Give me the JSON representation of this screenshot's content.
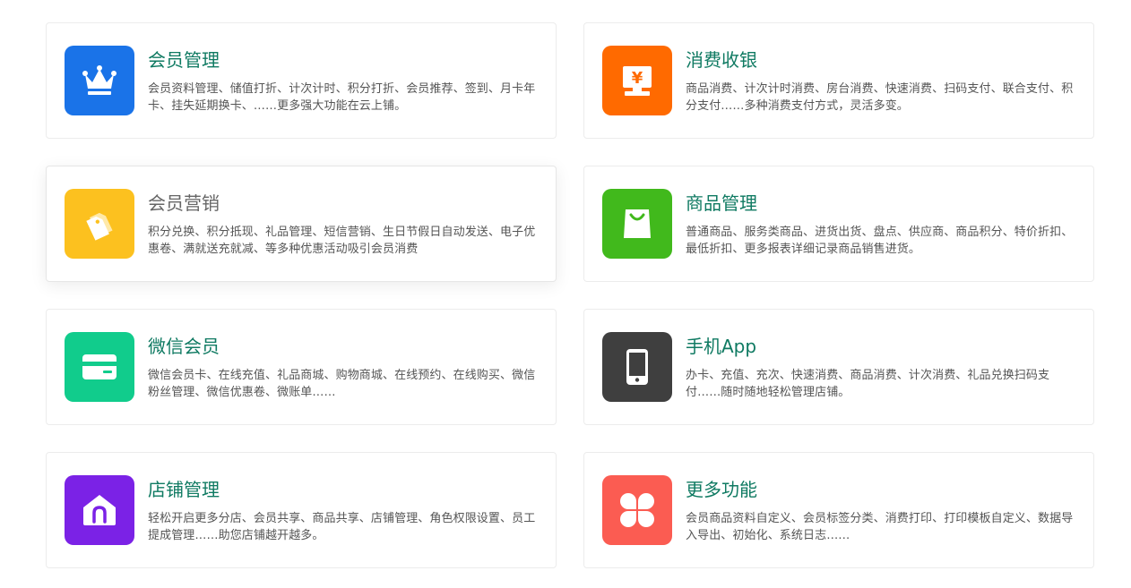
{
  "features": [
    {
      "title": "会员管理",
      "desc": "会员资料管理、储值打折、计次计时、积分打折、会员推荐、签到、月卡年卡、挂失延期换卡、……更多强大功能在云上铺。",
      "icon": "crown-icon",
      "color": "#1a73e8"
    },
    {
      "title": "消费收银",
      "desc": "商品消费、计次计时消费、房台消费、快速消费、扫码支付、联合支付、积分支付……多种消费支付方式，灵活多变。",
      "icon": "cash-register-icon",
      "color": "#ff6a00"
    },
    {
      "title": "会员营销",
      "desc": "积分兑换、积分抵现、礼品管理、短信营销、生日节假日自动发送、电子优惠卷、满就送充就减、等多种优惠活动吸引会员消费",
      "icon": "price-tags-icon",
      "color": "#fcc11f"
    },
    {
      "title": "商品管理",
      "desc": "普通商品、服务类商品、进货出货、盘点、供应商、商品积分、特价折扣、最低折扣、更多报表详细记录商品销售进货。",
      "icon": "shopping-bag-icon",
      "color": "#41b91c"
    },
    {
      "title": "微信会员",
      "desc": "微信会员卡、在线充值、礼品商城、购物商城、在线预约、在线购买、微信粉丝管理、微信优惠卷、微账单……",
      "icon": "card-icon",
      "color": "#11cc8c"
    },
    {
      "title": "手机App",
      "desc": "办卡、充值、充次、快速消费、商品消费、计次消费、礼品兑换扫码支付……随时随地轻松管理店铺。",
      "icon": "phone-icon",
      "color": "#3f3f3f"
    },
    {
      "title": "店铺管理",
      "desc": "轻松开启更多分店、会员共享、商品共享、店铺管理、角色权限设置、员工提成管理……助您店铺越开越多。",
      "icon": "store-icon",
      "color": "#7b22e6"
    },
    {
      "title": "更多功能",
      "desc": "会员商品资料自定义、会员标签分类、消费打印、打印模板自定义、数据导入导出、初始化、系统日志……",
      "icon": "grid-petals-icon",
      "color": "#fb5c52"
    }
  ]
}
